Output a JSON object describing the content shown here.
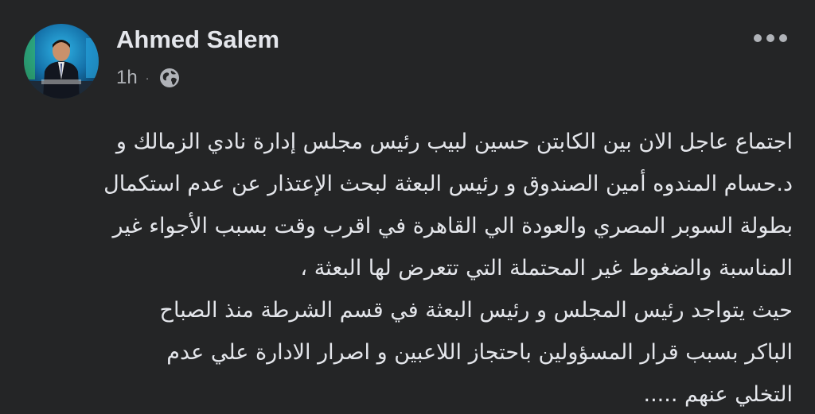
{
  "post": {
    "author": "Ahmed Salem",
    "time": "1h",
    "time_separator": "·",
    "privacy_icon": "globe-icon",
    "more_icon": "more-horizontal-icon",
    "body_lines": [
      "اجتماع عاجل الان بين الكابتن حسين لبيب رئيس مجلس إدارة نادي الزمالك و",
      "د.حسام المندوه أمين الصندوق و رئيس البعثة لبحث الإعتذار عن عدم استكمال",
      "بطولة السوبر المصري والعودة  الي القاهرة في اقرب وقت بسبب الأجواء غير",
      "المناسبة والضغوط غير المحتملة التي تتعرض لها البعثة ،",
      "حيث يتواجد رئيس المجلس و رئيس البعثة في قسم الشرطة  منذ الصباح",
      "الباكر بسبب قرار المسؤولين   باحتجاز  اللاعبين و اصرار الادارة علي عدم",
      "التخلي عنهم ....."
    ]
  },
  "colors": {
    "background": "#242526",
    "primary_text": "#e4e6eb",
    "secondary_text": "#b0b3b8"
  }
}
